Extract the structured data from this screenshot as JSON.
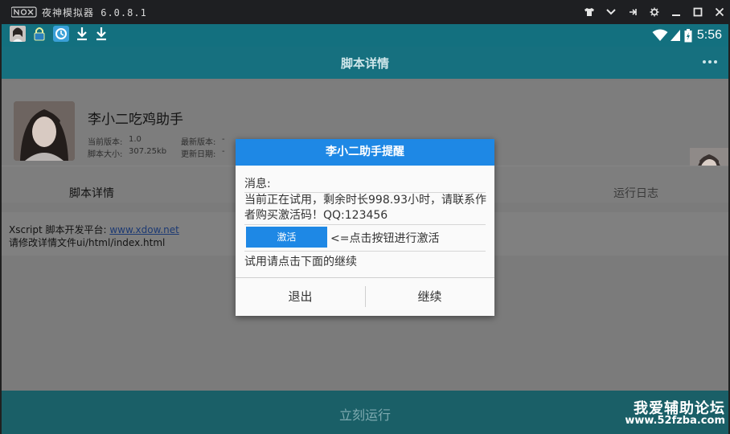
{
  "window": {
    "logo_text": "nox",
    "title": "夜神模拟器 6.0.8.1",
    "controls": [
      "tshirt-icon",
      "chevron-down-icon",
      "pin-icon",
      "gear-icon",
      "minimize-icon",
      "maximize-icon",
      "close-icon"
    ]
  },
  "status_bar": {
    "time": "5:56",
    "left_icons": [
      "avatar-icon",
      "lock-icon",
      "app-icon",
      "download-icon",
      "download-icon"
    ],
    "right_icons": [
      "wifi-icon",
      "signal-icon",
      "battery-icon"
    ]
  },
  "app_bar": {
    "title": "脚本详情",
    "menu_icon": "more-icon"
  },
  "script": {
    "name": "李小二吃鸡助手",
    "current_version_label": "当前版本:",
    "current_version": "1.0",
    "latest_version_label": "最新版本:",
    "latest_version": "-",
    "size_label": "脚本大小:",
    "size": "307.25kb",
    "update_date_label": "更新日期:",
    "update_date": "-"
  },
  "tabs": {
    "details": "脚本详情",
    "log": "运行日志"
  },
  "body": {
    "platform_prefix": "Xscript 脚本开发平台:",
    "platform_link": "www.xdow.net",
    "edit_hint": "请修改详情文件ui/html/index.html"
  },
  "run_button": {
    "label": "立刻运行"
  },
  "watermark": {
    "line1": "我爱辅助论坛",
    "line2": "www.52fzba.com"
  },
  "dialog": {
    "title": "李小二助手提醒",
    "message_label": "消息:",
    "message": "当前正在试用，剩余时长998.93小时，请联系作者购买激活码！QQ:123456",
    "activate_button": "激活",
    "activate_hint": "<=点击按钮进行激活",
    "trial_hint": "试用请点击下面的继续",
    "exit_button": "退出",
    "continue_button": "继续"
  },
  "colors": {
    "status_bar": "#13707f",
    "app_bar": "#16707f",
    "dialog_accent": "#1e88e5",
    "dim_overlay": "#7b7b7b"
  }
}
